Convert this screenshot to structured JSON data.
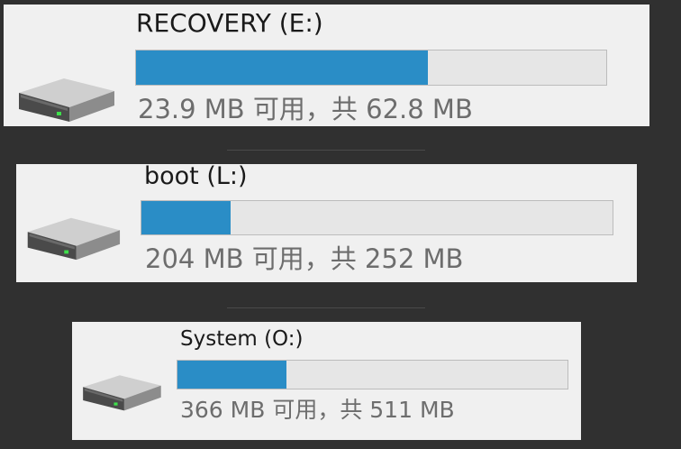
{
  "drives": [
    {
      "name": "RECOVERY (E:)",
      "space_text": "23.9 MB 可用，共 62.8 MB",
      "used_fraction": 0.62,
      "icon": "hard-drive-icon"
    },
    {
      "name": "boot (L:)",
      "space_text": "204 MB 可用，共 252 MB",
      "used_fraction": 0.19,
      "icon": "hard-drive-icon"
    },
    {
      "name": "System (O:)",
      "space_text": "366 MB 可用，共 511 MB",
      "used_fraction": 0.28,
      "icon": "hard-drive-icon"
    }
  ],
  "colors": {
    "bar_fill": "#2a8dc6",
    "bar_track": "#e6e6e6",
    "card_bg": "#f0f0f0",
    "page_bg": "#303030"
  }
}
